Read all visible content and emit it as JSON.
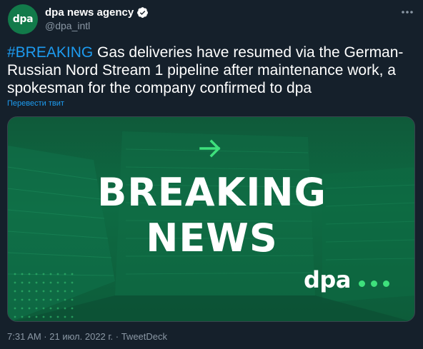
{
  "author": {
    "display_name": "dpa news agency",
    "handle": "@dpa_intl",
    "avatar_text": "dpa",
    "verified": true
  },
  "tweet": {
    "hashtag": "#BREAKING",
    "text": " Gas deliveries have resumed via the German-Russian Nord Stream 1 pipeline after maintenance work, a spokesman for the company confirmed to dpa",
    "translate_label": "Перевести твит"
  },
  "media": {
    "headline_line1": "BREAKING",
    "headline_line2": "NEWS",
    "logo_text": "dpa"
  },
  "meta": {
    "timestamp": "7:31 AM · 21 июл. 2022 г. · TweetDeck"
  },
  "colors": {
    "background": "#15202b",
    "link": "#1d9bf0",
    "muted": "#8b98a5",
    "brand_green": "#127a4a",
    "accent_green": "#3ee07c"
  },
  "icons": {
    "verified": "verified-badge-icon",
    "more": "more-options-icon",
    "arrow": "arrow-right-icon"
  }
}
